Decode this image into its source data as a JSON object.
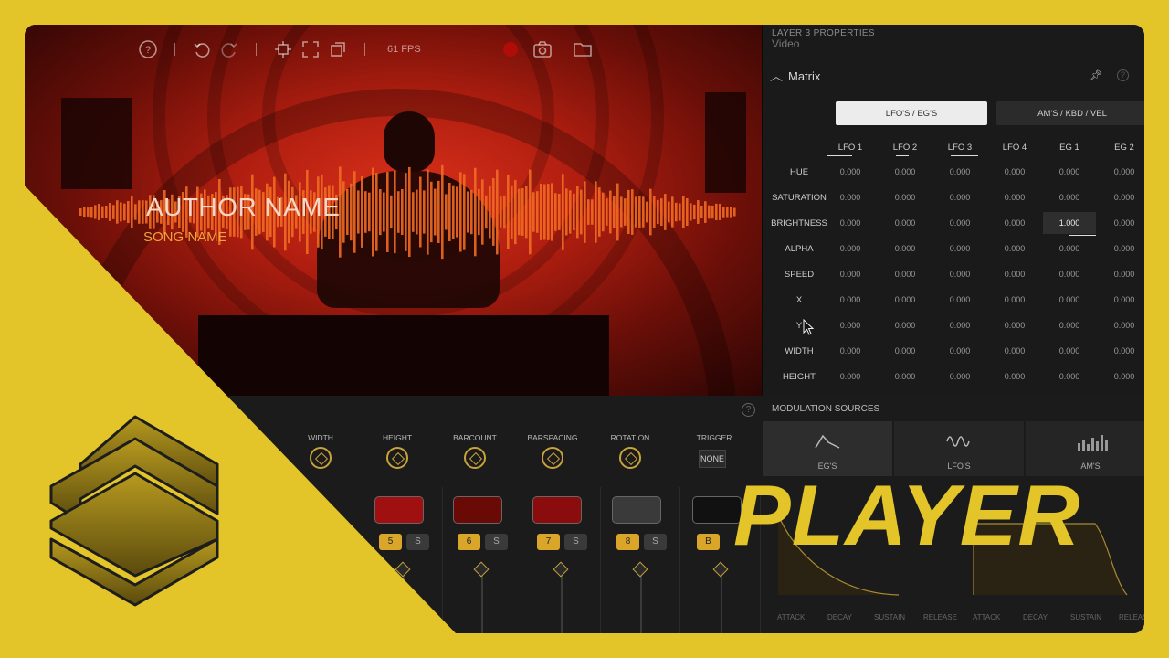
{
  "toolbar": {
    "fps": "61 FPS"
  },
  "preview": {
    "author": "AUTHOR NAME",
    "song": "SONG NAME"
  },
  "props": {
    "title": "LAYER 3 PROPERTIES",
    "prev_section": "Video",
    "section": "Matrix",
    "tabs": [
      "LFO'S / EG'S",
      "AM'S / KBD / VEL"
    ],
    "columns": [
      "LFO 1",
      "LFO 2",
      "LFO 3",
      "LFO 4",
      "EG 1",
      "EG 2"
    ],
    "rows": [
      {
        "label": "HUE",
        "values": [
          "0.000",
          "0.000",
          "0.000",
          "0.000",
          "0.000",
          "0.000"
        ]
      },
      {
        "label": "SATURATION",
        "values": [
          "0.000",
          "0.000",
          "0.000",
          "0.000",
          "0.000",
          "0.000"
        ]
      },
      {
        "label": "BRIGHTNESS",
        "values": [
          "0.000",
          "0.000",
          "0.000",
          "0.000",
          "1.000",
          "0.000"
        ]
      },
      {
        "label": "ALPHA",
        "values": [
          "0.000",
          "0.000",
          "0.000",
          "0.000",
          "0.000",
          "0.000"
        ]
      },
      {
        "label": "SPEED",
        "values": [
          "0.000",
          "0.000",
          "0.000",
          "0.000",
          "0.000",
          "0.000"
        ]
      },
      {
        "label": "X",
        "values": [
          "0.000",
          "0.000",
          "0.000",
          "0.000",
          "0.000",
          "0.000"
        ]
      },
      {
        "label": "Y",
        "values": [
          "0.000",
          "0.000",
          "0.000",
          "0.000",
          "0.000",
          "0.000"
        ]
      },
      {
        "label": "WIDTH",
        "values": [
          "0.000",
          "0.000",
          "0.000",
          "0.000",
          "0.000",
          "0.000"
        ]
      },
      {
        "label": "HEIGHT",
        "values": [
          "0.000",
          "0.000",
          "0.000",
          "0.000",
          "0.000",
          "0.000"
        ]
      }
    ]
  },
  "controls": {
    "knobs": [
      "WIDTH",
      "HEIGHT",
      "BARCOUNT",
      "BARSPACING",
      "ROTATION"
    ],
    "trigger_label": "TRIGGER",
    "trigger_value": "NONE"
  },
  "channels": [
    {
      "num": "5",
      "solo": "S",
      "thumb_color": "#a01010"
    },
    {
      "num": "6",
      "solo": "S",
      "thumb_color": "#6a0a06"
    },
    {
      "num": "7",
      "solo": "S",
      "thumb_color": "#8a0c0c"
    },
    {
      "num": "8",
      "solo": "S",
      "thumb_color": "#3a3a3a"
    },
    {
      "num": "B",
      "solo": "",
      "thumb_color": "#111111"
    }
  ],
  "modulation": {
    "title": "MODULATION SOURCES",
    "tabs": [
      "EG'S",
      "LFO'S",
      "AM'S"
    ],
    "envelope_labels": [
      "ATTACK",
      "DECAY",
      "SUSTAIN",
      "RELEASE",
      "ATTACK",
      "DECAY",
      "SUSTAIN",
      "RELEASE"
    ]
  },
  "overlay": {
    "title": "PLAYER"
  },
  "colors": {
    "accent": "#e3c52a",
    "knob": "#c8a23c",
    "badge": "#d9a62a"
  }
}
